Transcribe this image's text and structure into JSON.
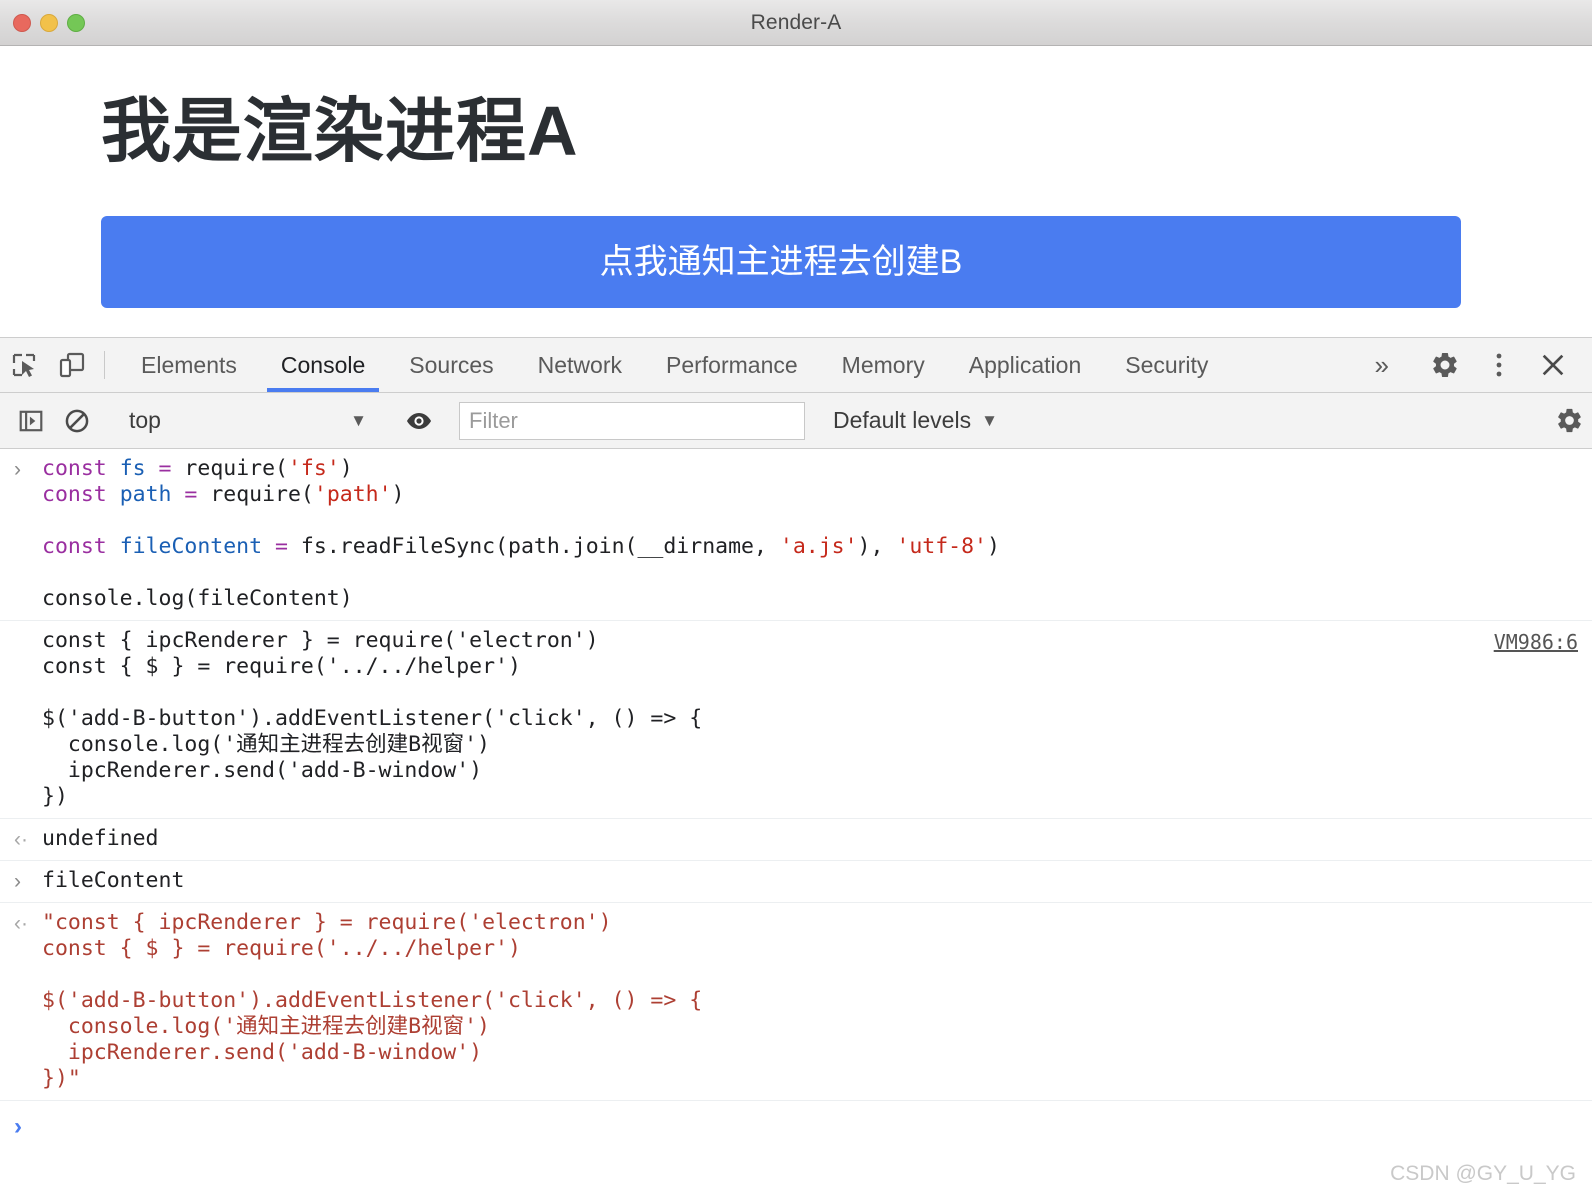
{
  "window": {
    "title": "Render-A",
    "traffic_lights": [
      "close",
      "minimize",
      "maximize"
    ]
  },
  "page": {
    "heading": "我是渲染进程A",
    "button_label": "点我通知主进程去创建B",
    "button_color": "#4a7cf0"
  },
  "devtools": {
    "tabs": [
      {
        "label": "Elements",
        "active": false
      },
      {
        "label": "Console",
        "active": true
      },
      {
        "label": "Sources",
        "active": false
      },
      {
        "label": "Network",
        "active": false
      },
      {
        "label": "Performance",
        "active": false
      },
      {
        "label": "Memory",
        "active": false
      },
      {
        "label": "Application",
        "active": false
      },
      {
        "label": "Security",
        "active": false
      }
    ],
    "more_tabs_label": "»",
    "active_tab_underline_color": "#4a7cf0",
    "toolbar": {
      "context_value": "top",
      "context_caret": "▼",
      "filter_placeholder": "Filter",
      "filter_value": "",
      "levels_label": "Default levels",
      "levels_caret": "▼"
    },
    "console": {
      "messages": [
        {
          "kind": "input",
          "gutter": "›",
          "source_link": "",
          "lines": [
            [
              {
                "t": "const",
                "c": "kw"
              },
              {
                "t": " "
              },
              {
                "t": "fs",
                "c": "var"
              },
              {
                "t": " "
              },
              {
                "t": "=",
                "c": "op"
              },
              {
                "t": " require("
              },
              {
                "t": "'fs'",
                "c": "str"
              },
              {
                "t": ")"
              }
            ],
            [
              {
                "t": "const",
                "c": "kw"
              },
              {
                "t": " "
              },
              {
                "t": "path",
                "c": "var"
              },
              {
                "t": " "
              },
              {
                "t": "=",
                "c": "op"
              },
              {
                "t": " require("
              },
              {
                "t": "'path'",
                "c": "str"
              },
              {
                "t": ")"
              }
            ],
            [],
            [
              {
                "t": "const",
                "c": "kw"
              },
              {
                "t": " "
              },
              {
                "t": "fileContent",
                "c": "var"
              },
              {
                "t": " "
              },
              {
                "t": "=",
                "c": "op"
              },
              {
                "t": " fs.readFileSync(path.join(__dirname, "
              },
              {
                "t": "'a.js'",
                "c": "str"
              },
              {
                "t": "), "
              },
              {
                "t": "'utf-8'",
                "c": "str"
              },
              {
                "t": ")"
              }
            ],
            [],
            [
              {
                "t": "console.log(fileContent)"
              }
            ]
          ]
        },
        {
          "kind": "log",
          "gutter": "",
          "source_link": "VM986:6",
          "text": "const { ipcRenderer } = require('electron')\nconst { $ } = require('../../helper')\n\n$('add-B-button').addEventListener('click', () => {\n  console.log('通知主进程去创建B视窗')\n  ipcRenderer.send('add-B-window')\n})"
        },
        {
          "kind": "result",
          "gutter": "‹·",
          "source_link": "",
          "text": "undefined"
        },
        {
          "kind": "input",
          "gutter": "›",
          "source_link": "",
          "text": "fileContent"
        },
        {
          "kind": "string-result",
          "gutter": "‹·",
          "source_link": "",
          "text": "\"const { ipcRenderer } = require('electron')\nconst { $ } = require('../../helper')\n\n$('add-B-button').addEventListener('click', () => {\n  console.log('通知主进程去创建B视窗')\n  ipcRenderer.send('add-B-window')\n})\""
        }
      ],
      "prompt_glyph": "›"
    }
  },
  "watermark": "CSDN @GY_U_YG"
}
